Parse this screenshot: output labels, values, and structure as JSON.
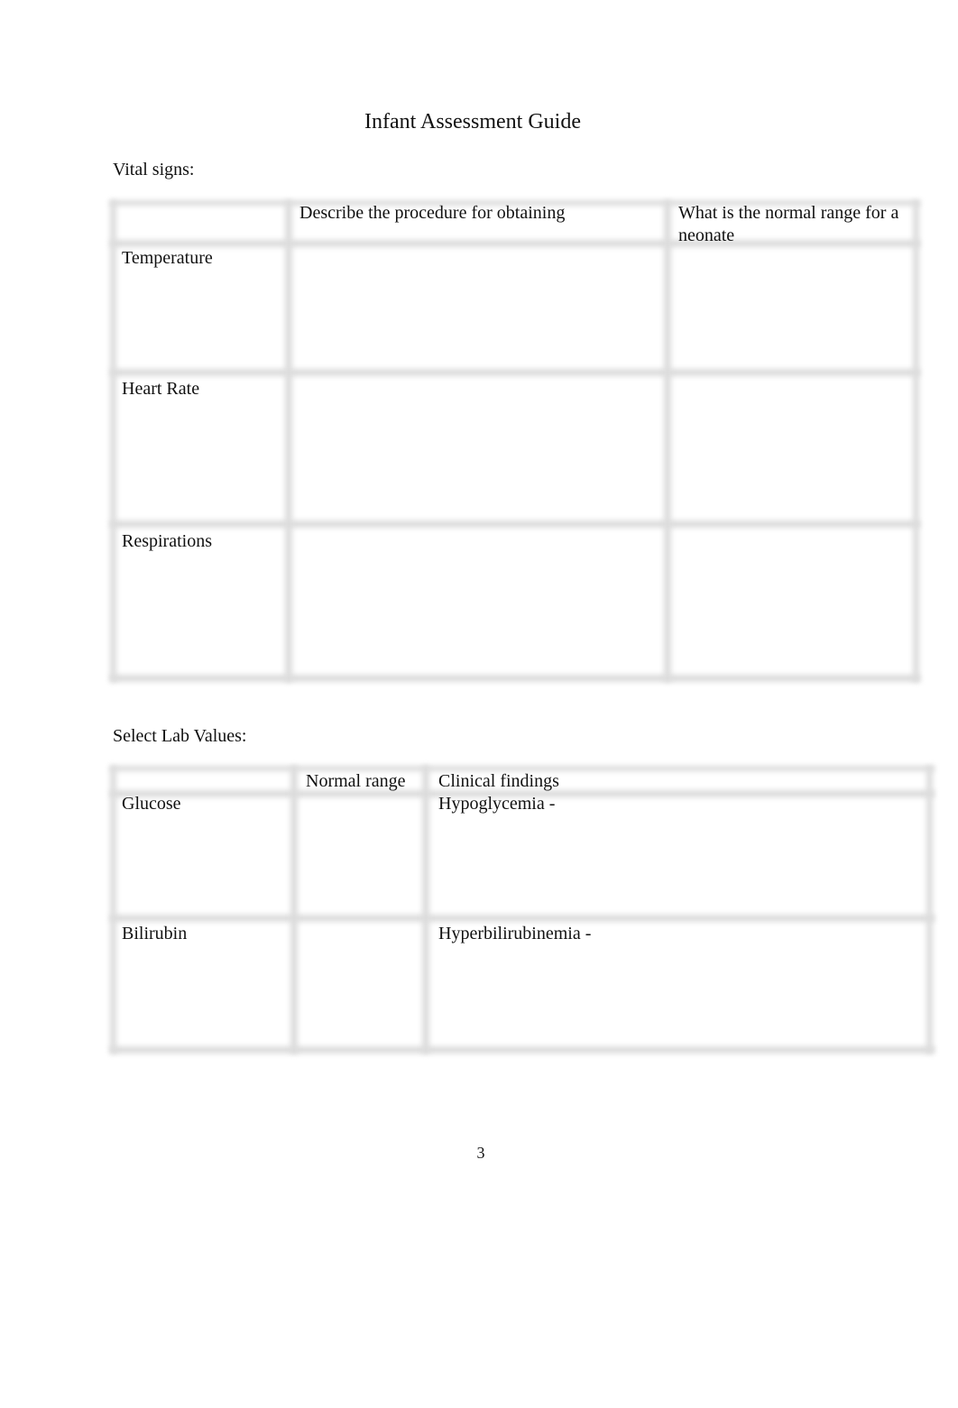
{
  "document": {
    "title": "Infant Assessment Guide",
    "page_number": "3"
  },
  "vital_signs": {
    "label": "Vital signs:",
    "headers": [
      "",
      "Describe the procedure for obtaining",
      "What is the normal range for a neonate"
    ],
    "rows": [
      {
        "name": "Temperature",
        "procedure": "",
        "normal_range": ""
      },
      {
        "name": "Heart Rate",
        "procedure": "",
        "normal_range": ""
      },
      {
        "name": "Respirations",
        "procedure": "",
        "normal_range": ""
      }
    ]
  },
  "lab_values": {
    "label": "Select Lab Values:",
    "headers": [
      "",
      "Normal range",
      "Clinical findings"
    ],
    "rows": [
      {
        "name": "Glucose",
        "normal_range": "",
        "clinical_findings": "Hypoglycemia -"
      },
      {
        "name": "Bilirubin",
        "normal_range": "",
        "clinical_findings": "Hyperbilirubinemia -"
      }
    ]
  }
}
